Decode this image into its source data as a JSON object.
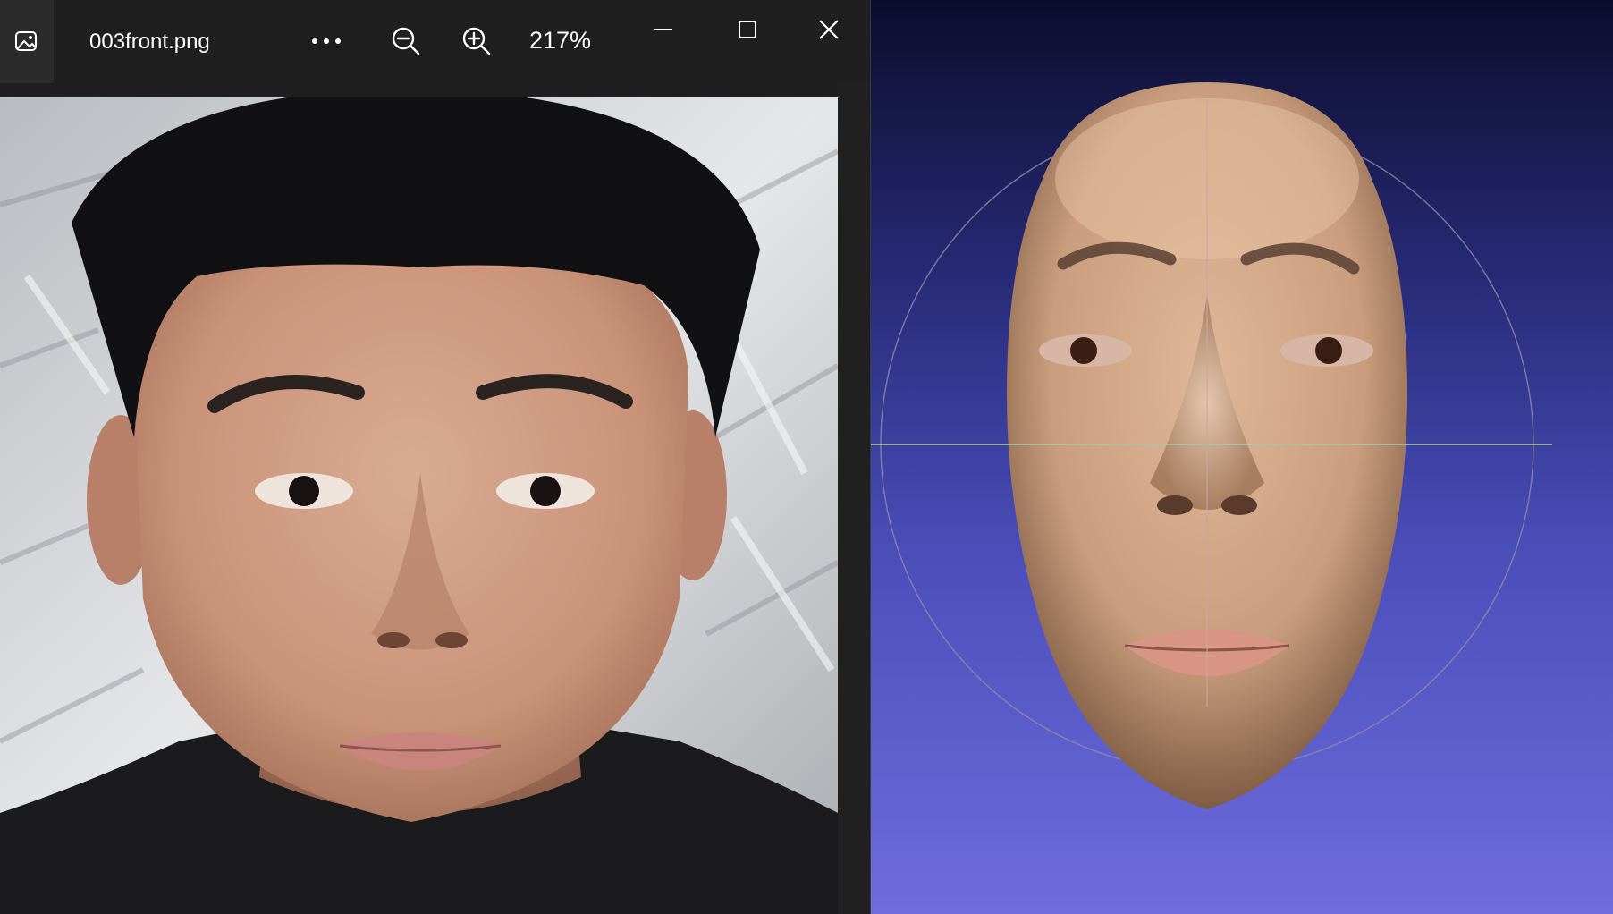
{
  "viewer": {
    "filename": "003front.png",
    "zoom_level": "217%",
    "icons": {
      "app": "gallery-icon",
      "more": "more-options-icon",
      "zoom_out": "zoom-out-icon",
      "zoom_in": "zoom-in-icon",
      "minimize": "minimize-icon",
      "maximize": "maximize-icon",
      "close": "close-icon"
    }
  },
  "viewport": {
    "background_top": "#0c0d2c",
    "background_bottom": "#6f6cdf"
  }
}
